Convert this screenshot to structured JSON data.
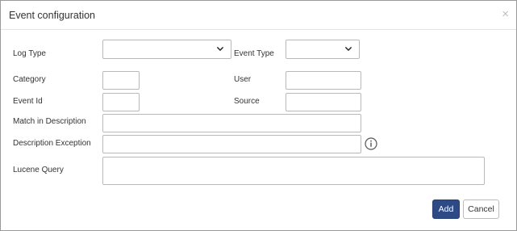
{
  "dialog": {
    "title": "Event configuration",
    "close_symbol": "×"
  },
  "form": {
    "log_type": {
      "label": "Log Type",
      "selected": ""
    },
    "event_type": {
      "label": "Event Type",
      "selected": ""
    },
    "category": {
      "label": "Category",
      "value": ""
    },
    "user": {
      "label": "User",
      "value": ""
    },
    "event_id": {
      "label": "Event Id",
      "value": ""
    },
    "source": {
      "label": "Source",
      "value": ""
    },
    "match_in_description": {
      "label": "Match in Description",
      "value": ""
    },
    "description_exception": {
      "label": "Description Exception",
      "value": "",
      "icon": "info-icon"
    },
    "lucene_query": {
      "label": "Lucene Query",
      "value": ""
    }
  },
  "footer": {
    "add_label": "Add",
    "cancel_label": "Cancel"
  },
  "colors": {
    "primary_button": "#2e4a86",
    "border": "#b9b9b9",
    "text": "#333333"
  }
}
